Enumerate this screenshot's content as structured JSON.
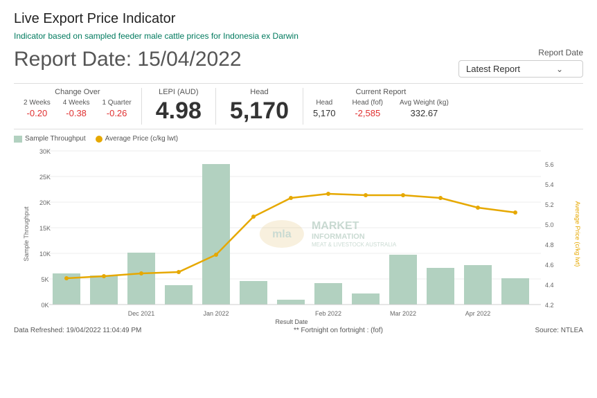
{
  "page": {
    "title": "Live Export Price Indicator",
    "subtitle": "Indicator based on sampled feeder male cattle prices for Indonesia ex Darwin"
  },
  "report": {
    "date_label": "Report Date: 15/04/2022",
    "selector_title": "Report Date",
    "selector_value": "Latest Report"
  },
  "change_over": {
    "title": "Change Over",
    "columns": [
      "2 Weeks",
      "4 Weeks",
      "1 Quarter"
    ],
    "values": [
      "-0.20",
      "-0.38",
      "-0.26"
    ]
  },
  "lepi": {
    "label": "LEPI (AUD)",
    "value": "4.98"
  },
  "head": {
    "label": "Head",
    "value": "5,170"
  },
  "current_report": {
    "title": "Current Report",
    "columns": [
      "Head",
      "Head (fof)",
      "Avg Weight (kg)"
    ],
    "values": [
      "5,170",
      "-2,585",
      "332.67"
    ]
  },
  "legend": {
    "throughput_label": "Sample Throughput",
    "price_label": "Average Price (c/kg lwt)"
  },
  "chart": {
    "y_left_label": "Sample Throughput",
    "y_right_label": "Average Price (c/kg lwt)",
    "x_label": "Result Date",
    "y_left_ticks": [
      "0K",
      "5K",
      "10K",
      "15K",
      "20K",
      "25K",
      "30K"
    ],
    "y_right_ticks": [
      "4.2",
      "4.4",
      "4.6",
      "4.8",
      "5.0",
      "5.2",
      "5.4",
      "5.6"
    ],
    "bars": [
      {
        "label": "",
        "value": 6200
      },
      {
        "label": "",
        "value": 5800
      },
      {
        "label": "Dec 2021",
        "value": 10200
      },
      {
        "label": "",
        "value": 3800
      },
      {
        "label": "Jan 2022",
        "value": 27500
      },
      {
        "label": "",
        "value": 4700
      },
      {
        "label": "",
        "value": 900
      },
      {
        "label": "Feb 2022",
        "value": 4200
      },
      {
        "label": "",
        "value": 2200
      },
      {
        "label": "Mar 2022",
        "value": 9800
      },
      {
        "label": "",
        "value": 7200
      },
      {
        "label": "Apr 2022",
        "value": 7800
      },
      {
        "label": "",
        "value": 5200
      }
    ],
    "line_points": [
      4.44,
      4.46,
      4.48,
      4.49,
      4.65,
      5.0,
      5.18,
      5.22,
      5.2,
      5.2,
      5.18,
      5.06,
      5.02
    ]
  },
  "footer": {
    "refreshed": "Data Refreshed: 19/04/2022 11:04:49 PM",
    "footnote": "** Fortnight on fortnight : (fof)",
    "source": "Source: NTLEA"
  }
}
